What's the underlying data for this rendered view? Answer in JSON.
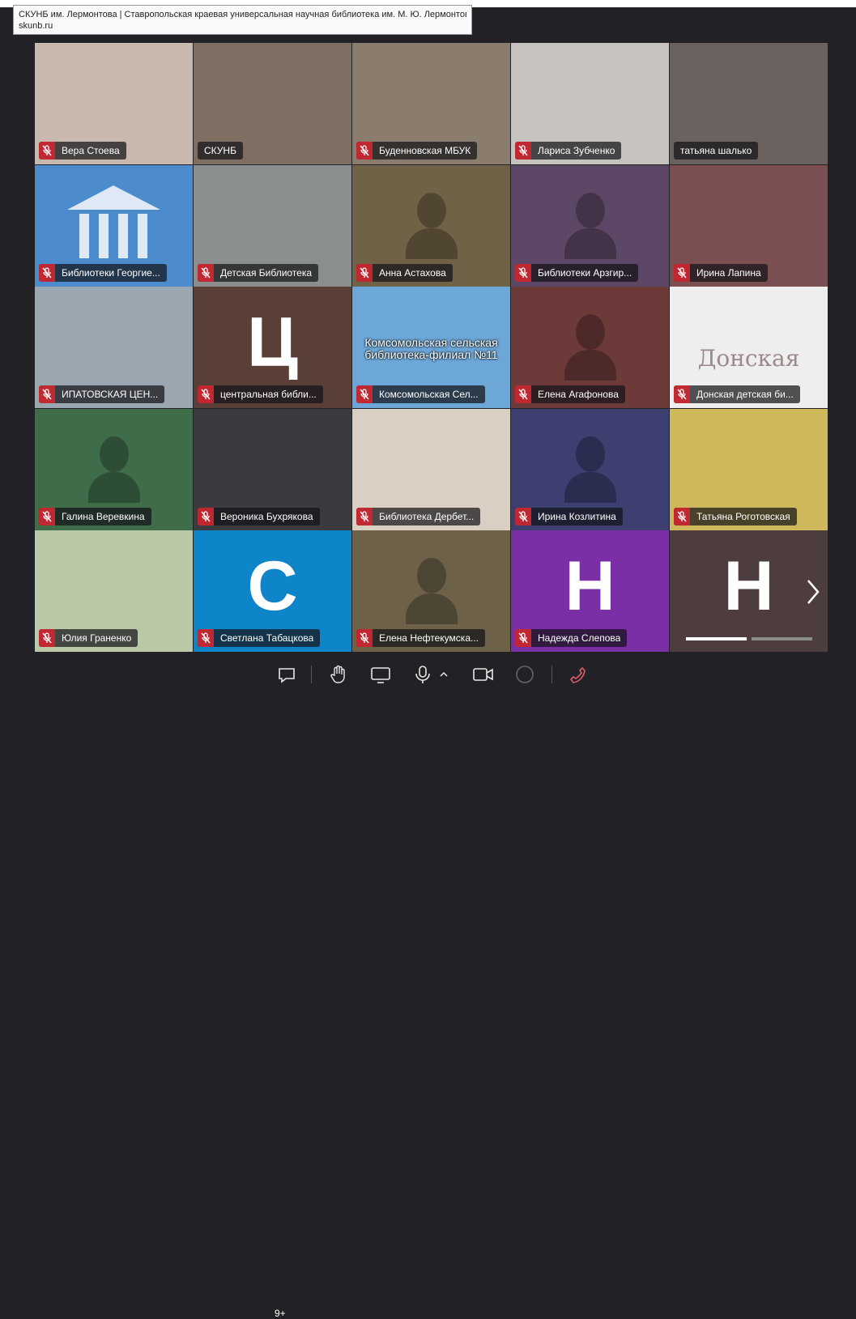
{
  "tooltip": {
    "title": "СКУНБ им. Лермонтова | Ставропольская краевая универсальная научная библиотека им. М. Ю. Лермонтова",
    "url": "skunb.ru"
  },
  "participants": [
    {
      "name": "Вера Стоева",
      "muted": true,
      "bg": "#c8b8ae"
    },
    {
      "name": "СКУНБ",
      "muted": false,
      "bg": "#7f6f62"
    },
    {
      "name": "Буденновская МБУК",
      "muted": true,
      "bg": "#8a7d6e"
    },
    {
      "name": "Лариса Зубченко",
      "muted": true,
      "bg": "#c7c4c0"
    },
    {
      "name": "татьяна шалько",
      "muted": false,
      "bg": "#6b6260",
      "active": true
    },
    {
      "name": "Библиотеки Георгие...",
      "muted": true,
      "bg": "#4d8ccc",
      "logo": "building"
    },
    {
      "name": "Детская Библиотека",
      "muted": true,
      "bg": "#8a8f8e"
    },
    {
      "name": "Анна Астахова",
      "muted": true,
      "bg": "#6f6246",
      "avatar": true
    },
    {
      "name": "Библиотеки Арзгир...",
      "muted": true,
      "bg": "#5d4766",
      "avatar": true
    },
    {
      "name": "Ирина Лапина",
      "muted": true,
      "bg": "#7b4f52"
    },
    {
      "name": "ИПАТОВСКАЯ ЦЕН...",
      "muted": true,
      "bg": "#9aa6b0"
    },
    {
      "name": "центральная библи...",
      "muted": true,
      "bg": "#5a3f39",
      "letter": "Ц"
    },
    {
      "name": "Комсомольская Сел...",
      "muted": true,
      "bg": "#6da7d8",
      "banner": "Комсомольская сельская библиотека-филиал №11"
    },
    {
      "name": "Елена Агафонова",
      "muted": true,
      "bg": "#6d3a3a",
      "avatar": true
    },
    {
      "name": "Донская детская би...",
      "muted": true,
      "bg": "#eeeeee",
      "cloud": "Донская"
    },
    {
      "name": "Галина Веревкина",
      "muted": true,
      "bg": "#3f6d4a",
      "avatar": true
    },
    {
      "name": "Вероника Бухрякова",
      "muted": true,
      "bg": "#3b3b3f"
    },
    {
      "name": "Библиотека Дербет...",
      "muted": true,
      "bg": "#d9cfc2"
    },
    {
      "name": "Ирина Козлитина",
      "muted": true,
      "bg": "#3c3f70",
      "avatar": true
    },
    {
      "name": "Татьяна Роготовская",
      "muted": true,
      "bg": "#cfb85c"
    },
    {
      "name": "Юлия Граненко",
      "muted": true,
      "bg": "#b9c9a8"
    },
    {
      "name": "Светлана Табацкова",
      "muted": true,
      "bg": "#0f85c9",
      "letter": "С"
    },
    {
      "name": "Елена Нефтекумска...",
      "muted": true,
      "bg": "#6d6148",
      "avatar": true
    },
    {
      "name": "Надежда Слепова",
      "muted": true,
      "bg": "#7a2fa7",
      "letter": "Н"
    },
    {
      "name": "",
      "muted": false,
      "bg": "#4d3d3f",
      "overflow": true,
      "letter": "Н"
    }
  ],
  "toolbar": {
    "badge": "9+",
    "items": [
      "chat-icon",
      "raise-hand-icon",
      "screen-share-icon",
      "microphone-icon",
      "chevron-up-icon",
      "camera-icon",
      "record-icon",
      "hang-up-icon"
    ]
  },
  "colors": {
    "accent": "#1e88e5",
    "muted": "#c82832",
    "hangup": "#e05a6a"
  }
}
